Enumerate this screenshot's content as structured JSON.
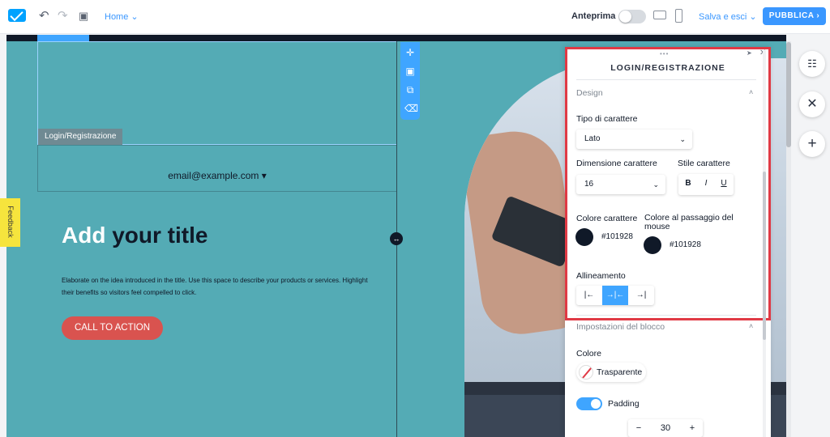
{
  "topbar": {
    "page_label": "Home",
    "preview_label": "Anteprima",
    "save_exit_label": "Salva e esci",
    "publish_label": "PUBBLICA"
  },
  "canvas": {
    "block_tag": "Login/Registrazione",
    "email_text": "email@example.com",
    "title_first": "Add",
    "title_rest": "your title",
    "body": "Elaborate on the idea introduced in the title. Use this space to describe your products or services. Highlight their benefits so visitors feel compelled to click.",
    "cta_label": "CALL TO ACTION"
  },
  "panel": {
    "title": "LOGIN/REGISTRAZIONE",
    "design_section": "Design",
    "font_type_label": "Tipo di carattere",
    "font_type_value": "Lato",
    "font_size_label": "Dimensione carattere",
    "font_size_value": "16",
    "font_style_label": "Stile carattere",
    "bold": "B",
    "italic": "I",
    "underline": "U",
    "font_color_label": "Colore carattere",
    "font_color_value": "#101928",
    "hover_color_label": "Colore al passaggio del mouse",
    "hover_color_value": "#101928",
    "align_label": "Allineamento",
    "block_section": "Impostazioni del blocco",
    "color_label": "Colore",
    "color_value": "Trasparente",
    "padding_label": "Padding",
    "padding_value": "30"
  },
  "feedback_label": "Feedback",
  "colors": {
    "accent": "#3fa5ff",
    "teal": "#54abb5",
    "cta": "#d9534f",
    "highlight": "#e03a45",
    "text_dark": "#101928"
  }
}
